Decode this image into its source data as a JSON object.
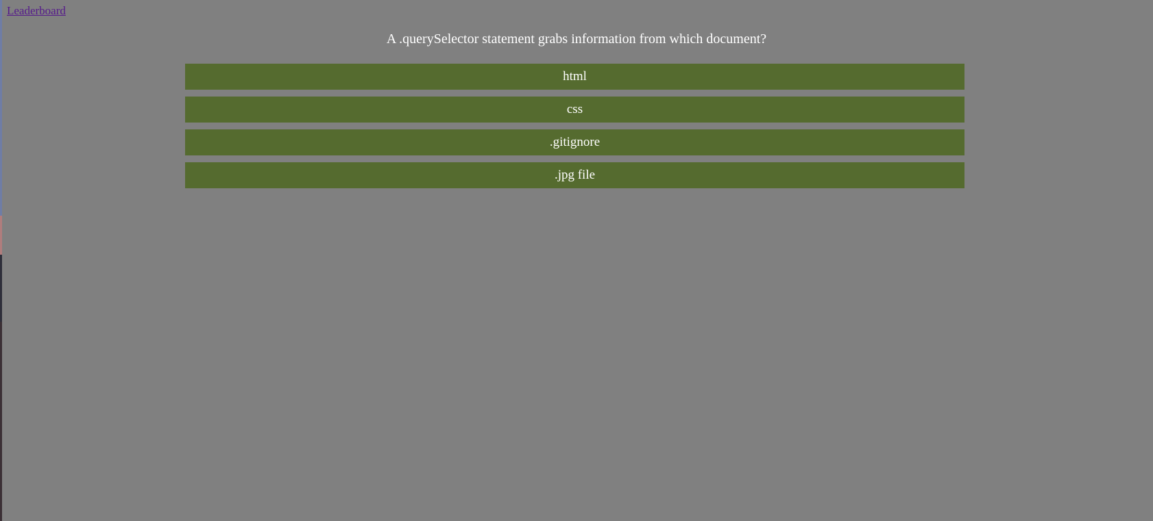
{
  "nav": {
    "leaderboard_label": "Leaderboard"
  },
  "quiz": {
    "question": "A .querySelector statement grabs information from which document?",
    "answers": [
      {
        "label": "html"
      },
      {
        "label": "css"
      },
      {
        "label": ".gitignore"
      },
      {
        "label": ".jpg file"
      }
    ]
  },
  "colors": {
    "background": "#808080",
    "answer_button": "#556b2f",
    "answer_text": "#ffffff",
    "link": "#551a8b"
  }
}
